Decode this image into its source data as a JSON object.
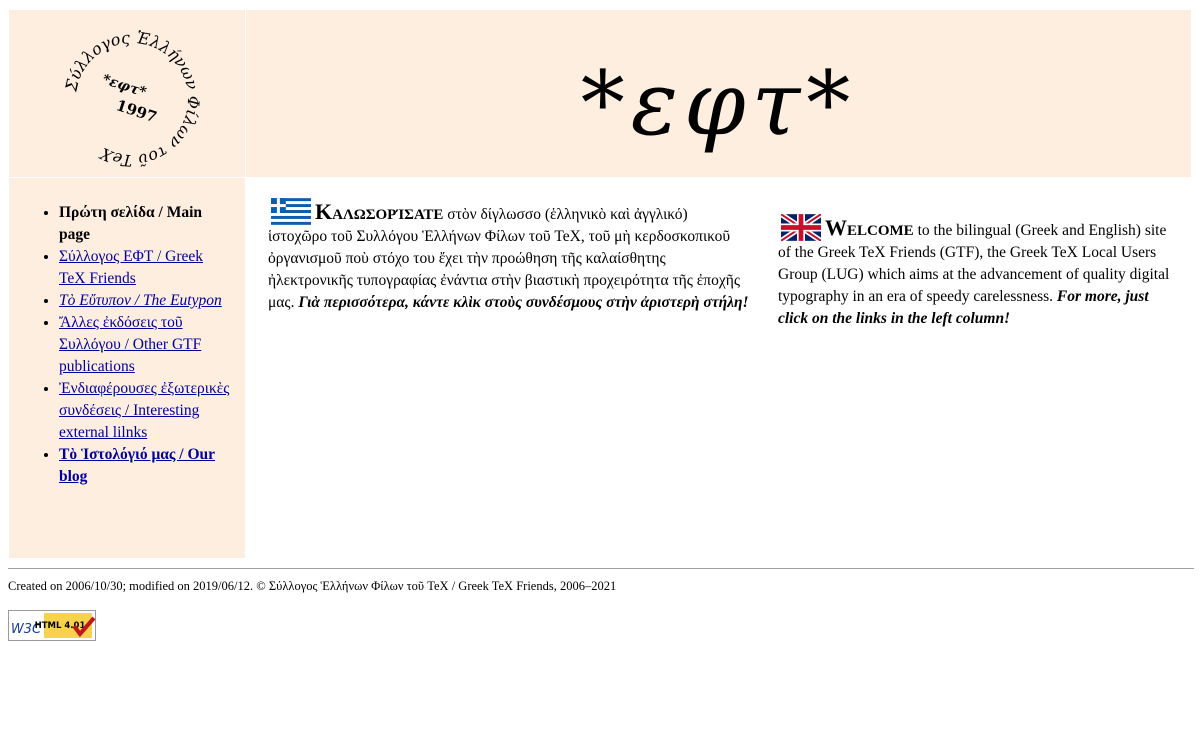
{
  "logo": {
    "ring_text": "Σύλλογος Ἑλλήνων Φίλων τοῦ TeX",
    "center_top": "*εφτ*",
    "center_year": "1997",
    "icon": "circular-seal-logo"
  },
  "header": {
    "title": "*εφτ*"
  },
  "nav": {
    "items": [
      {
        "label": "Πρώτη σελίδα / Main page",
        "current": true
      },
      {
        "label": "Σύλλογος ΕΦΤ / Greek TeX Friends"
      },
      {
        "label": "Τὸ Εὔτυπον / The Eutypon"
      },
      {
        "label": "Ἄλλες ἐκδόσεις τοῦ Συλλόγου / Other GTF publications"
      },
      {
        "label": "Ἐνδιαφέρουσες ἐξωτερικὲς συνδέσεις / Interesting external lilnks"
      },
      {
        "label": "Τὸ Ἱστολόγιό μας / Our blog"
      }
    ]
  },
  "greek": {
    "heading": "Καλωσορίσατε",
    "body": " στὸν δίγλωσσο (ἑλληνικὸ καὶ ἀγγλικό) ἱστοχῶρο τοῦ Συλλόγου Ἑλλήνων Φίλων τοῦ TeX, τοῦ μὴ κερδοσκοπικοῦ ὀργανισμοῦ ποὺ στόχο του ἔχει τὴν προώθηση τῆς καλαίσθητης ἠλεκτρονικῆς τυπογραφίας ἐνάντια στὴν βιαστικὴ προχειρότητα τῆς ἐποχῆς μας. ",
    "emphasis": "Γιὰ περισσότερα, κάντε κλὶκ στοὺς συνδέσμους στὴν ἀριστερὴ στήλη!",
    "flag_icon": "greek-flag-icon"
  },
  "english": {
    "heading": "Welcome",
    "body": " to the bilingual (Greek and English) site of the Greek TeX Friends (GTF), the Greek TeX Local Users Group (LUG) which aims at the advancement of quality digital typography in an era of speedy carelessness. ",
    "emphasis": "For more, just click on the links in the left column!",
    "flag_icon": "uk-flag-icon"
  },
  "footer": {
    "text": "Created on 2006/10/30; modified on 2019/06/12. © Σύλλογος Ἑλλήνων Φίλων τοῦ TeX / Greek TeX Friends, 2006–2021"
  },
  "badge": {
    "left": "W3C",
    "right": "HTML 4.01"
  },
  "colors": {
    "panel_bg": "#fdeee0",
    "link": "#00009c",
    "badge_yellow": "#f7d24d",
    "check_red": "#c0181a"
  }
}
